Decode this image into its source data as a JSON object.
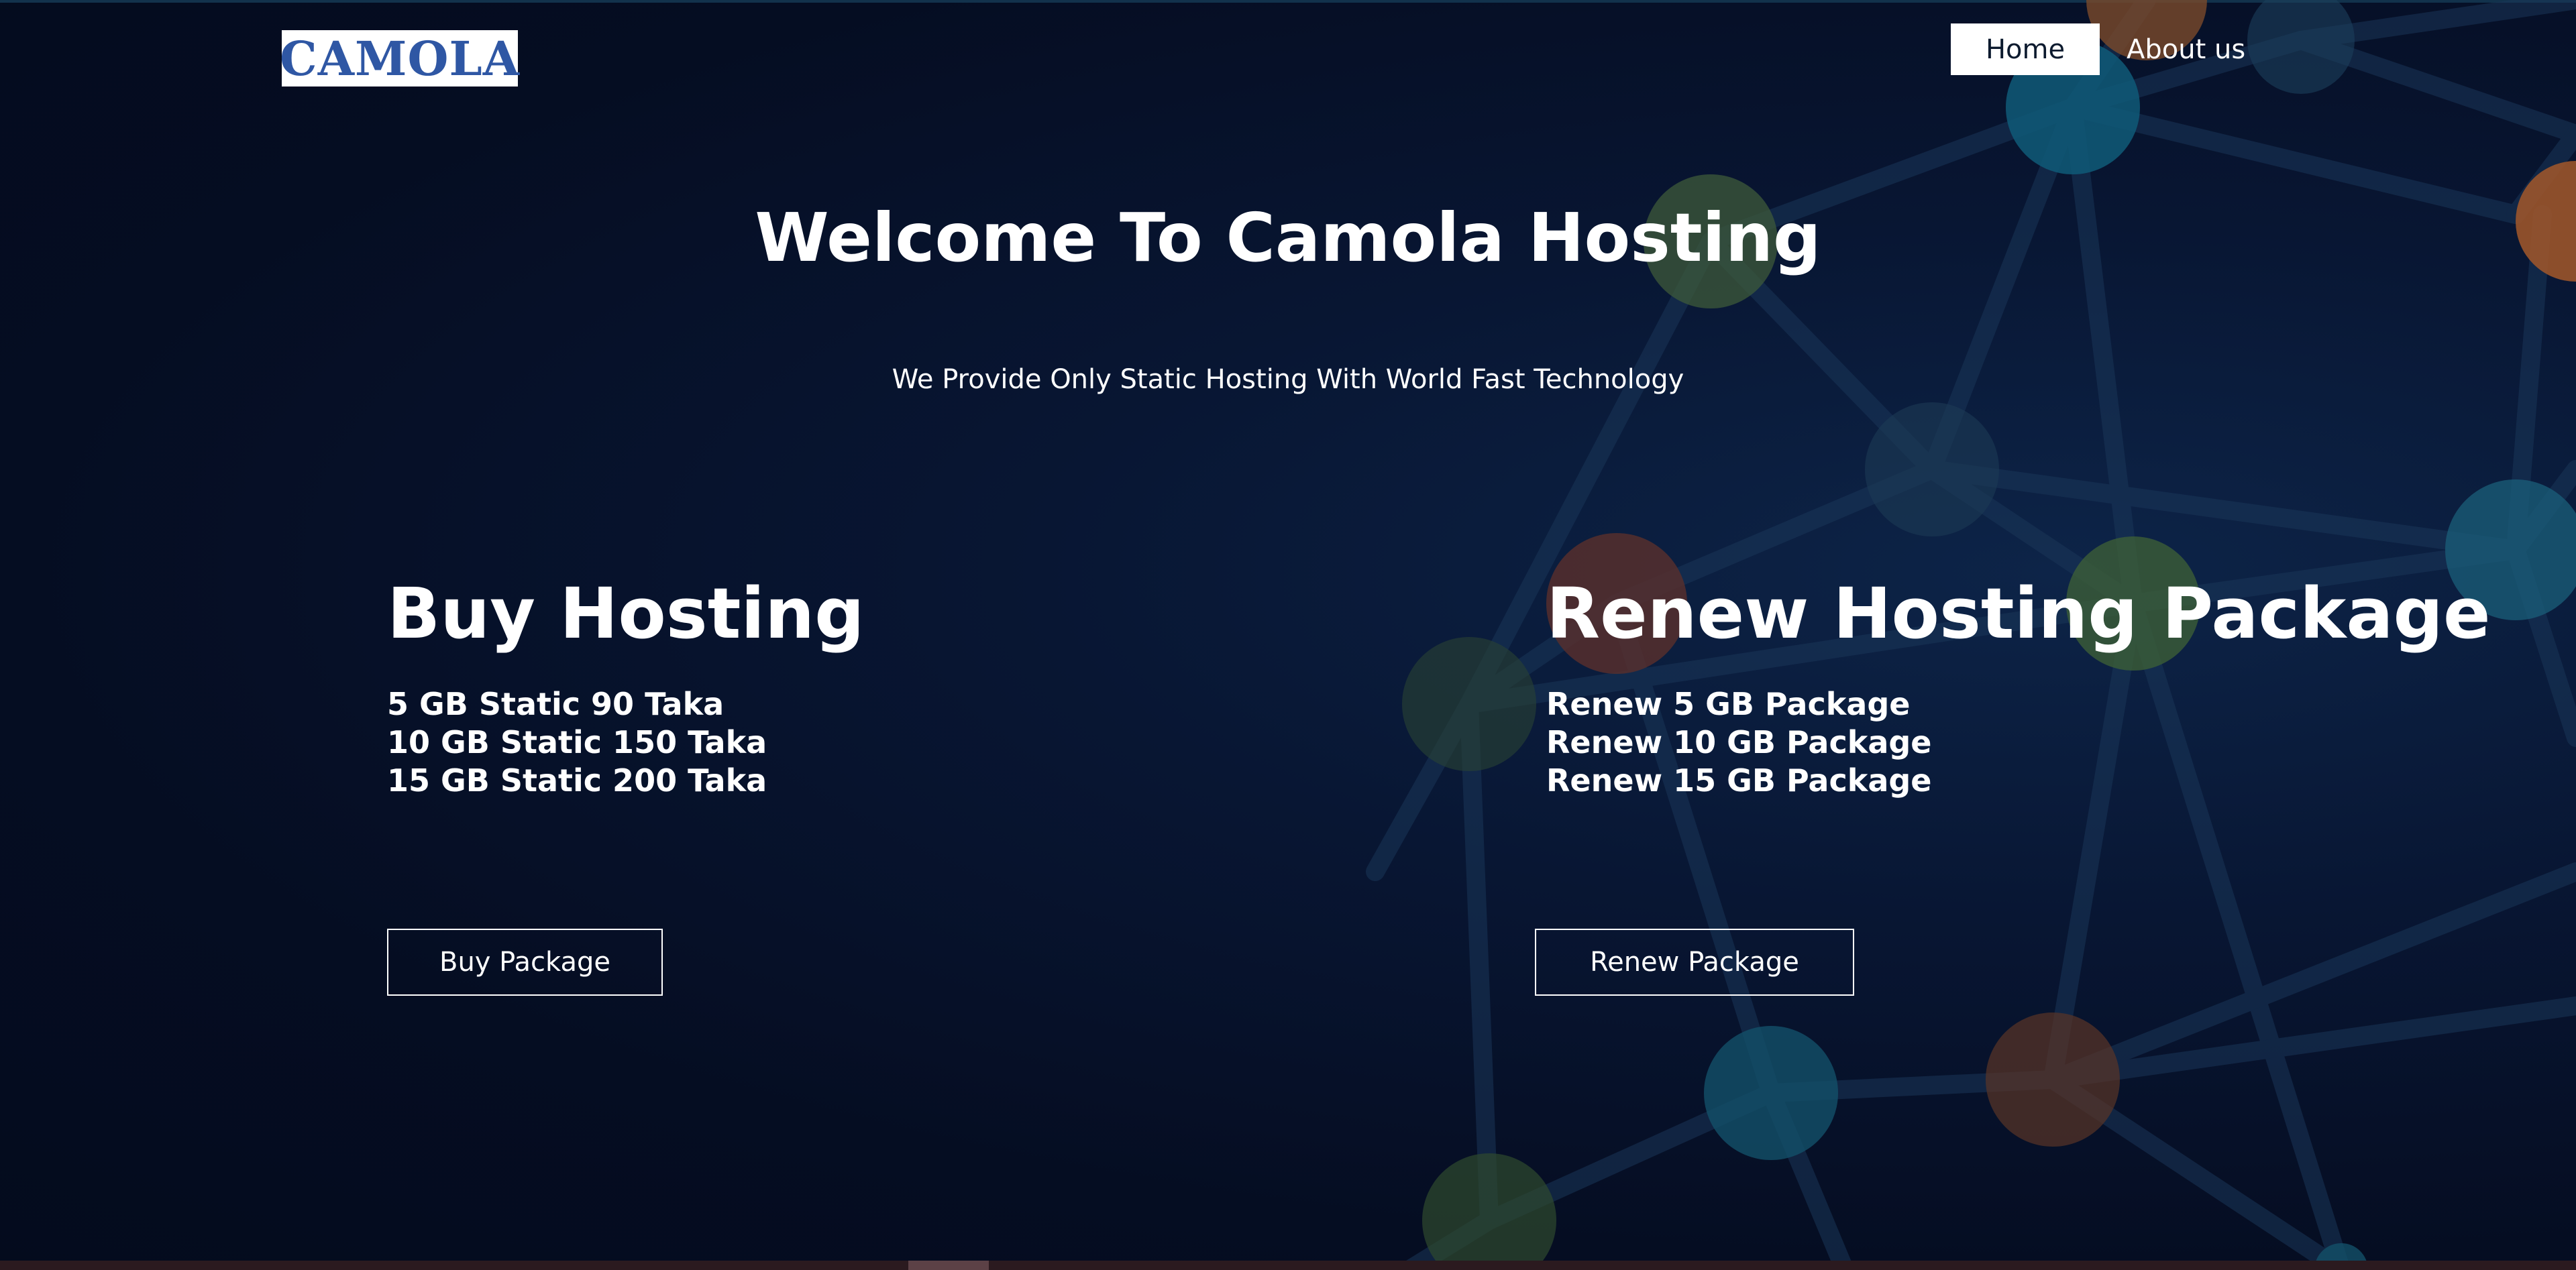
{
  "header": {
    "logo_text": "CAMOLA",
    "nav": {
      "home": "Home",
      "about": "About us"
    }
  },
  "hero": {
    "title": "Welcome To Camola Hosting",
    "subtitle": "We Provide Only Static Hosting With World Fast Technology"
  },
  "buy": {
    "heading": "Buy Hosting",
    "items": [
      "5 GB Static 90 Taka",
      "10 GB Static 150 Taka",
      "15 GB Static 200 Taka"
    ],
    "button": "Buy Package"
  },
  "renew": {
    "heading": "Renew Hosting Package",
    "items": [
      "Renew 5 GB Package",
      "Renew 10 GB Package",
      "Renew 15 GB Package"
    ],
    "button": "Renew Package"
  },
  "colors": {
    "background": "#061028",
    "logo_text": "#2f57a4",
    "text": "#ffffff"
  }
}
